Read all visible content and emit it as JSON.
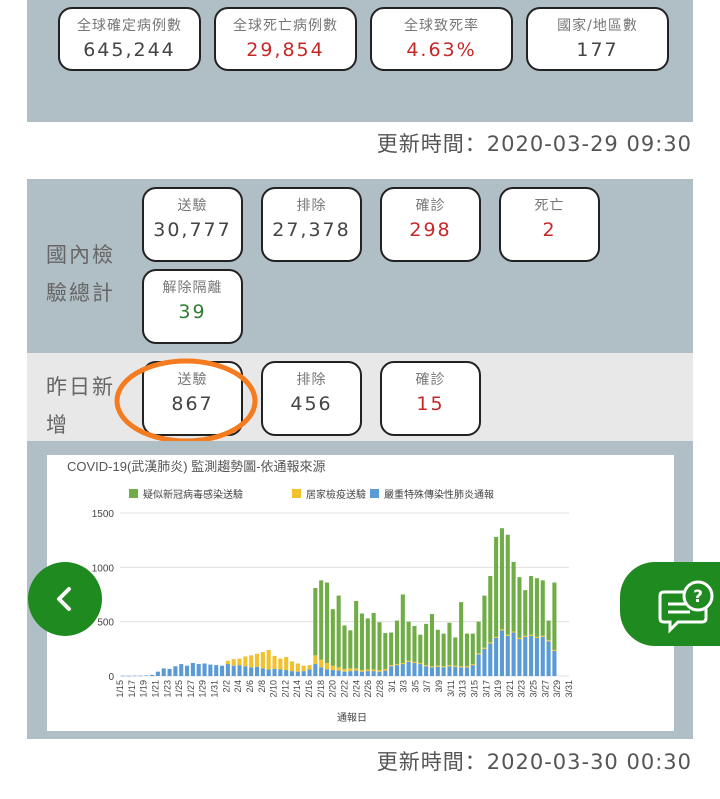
{
  "global": {
    "cards": [
      {
        "label": "全球確定病例數",
        "value": "645,244",
        "color": "#444444"
      },
      {
        "label": "全球死亡病例數",
        "value": "29,854",
        "color": "#c62828"
      },
      {
        "label": "全球致死率",
        "value": "4.63%",
        "color": "#c62828"
      },
      {
        "label": "國家/地區數",
        "value": "177",
        "color": "#444444"
      }
    ],
    "update": "更新時間：2020-03-29 09:30"
  },
  "domestic": {
    "title_line1": "國內檢",
    "title_line2": "驗總計",
    "cards": [
      {
        "label": "送驗",
        "value": "30,777"
      },
      {
        "label": "排除",
        "value": "27,378"
      },
      {
        "label": "確診",
        "value": "298"
      },
      {
        "label": "死亡",
        "value": "2"
      },
      {
        "label": "解除隔離",
        "value": "39"
      }
    ]
  },
  "yesterday": {
    "title_line1": "昨日新",
    "title_line2": "增",
    "cards": [
      {
        "label": "送驗",
        "value": "867"
      },
      {
        "label": "排除",
        "value": "456"
      },
      {
        "label": "確診",
        "value": "15"
      }
    ]
  },
  "update2": "更新時間：2020-03-30 00:30",
  "chart_data": {
    "type": "bar",
    "stacked": true,
    "title": "COVID-19(武漢肺炎) 監測趨勢圖-依通報來源",
    "xlabel": "通報日",
    "ylabel": "",
    "ylim": [
      0,
      1500
    ],
    "yticks": [
      0,
      500,
      1000,
      1500
    ],
    "legend_position": "top",
    "grid": true,
    "categories": [
      "1/15",
      "1/16",
      "1/17",
      "1/18",
      "1/19",
      "1/20",
      "1/21",
      "1/22",
      "1/23",
      "1/24",
      "1/25",
      "1/26",
      "1/27",
      "1/28",
      "1/29",
      "1/30",
      "1/31",
      "2/1",
      "2/2",
      "2/3",
      "2/4",
      "2/5",
      "2/6",
      "2/7",
      "2/8",
      "2/9",
      "2/10",
      "2/11",
      "2/12",
      "2/13",
      "2/14",
      "2/15",
      "2/16",
      "2/17",
      "2/18",
      "2/19",
      "2/20",
      "2/21",
      "2/22",
      "2/23",
      "2/24",
      "2/25",
      "2/26",
      "2/27",
      "2/28",
      "2/29",
      "3/1",
      "3/2",
      "3/3",
      "3/4",
      "3/5",
      "3/6",
      "3/7",
      "3/8",
      "3/9",
      "3/10",
      "3/11",
      "3/12",
      "3/13",
      "3/14",
      "3/15",
      "3/16",
      "3/17",
      "3/18",
      "3/19",
      "3/20",
      "3/21",
      "3/22",
      "3/23",
      "3/24",
      "3/25",
      "3/26",
      "3/27",
      "3/28",
      "3/29"
    ],
    "tick_labels": [
      "1/15",
      "1/17",
      "1/19",
      "1/21",
      "1/23",
      "1/25",
      "1/27",
      "1/29",
      "1/31",
      "2/2",
      "2/4",
      "2/6",
      "2/8",
      "2/10",
      "2/12",
      "2/14",
      "2/16",
      "2/18",
      "2/20",
      "2/22",
      "2/24",
      "2/26",
      "2/28",
      "3/1",
      "3/3",
      "3/5",
      "3/7",
      "3/9",
      "3/11",
      "3/13",
      "3/15",
      "3/17",
      "3/19",
      "3/21",
      "3/23",
      "3/25",
      "3/27",
      "3/29",
      "3/31"
    ],
    "series": [
      {
        "name": "嚴重特殊傳染性肺炎通報",
        "color": "#5b9bd5",
        "values": [
          2,
          2,
          3,
          3,
          5,
          10,
          40,
          70,
          65,
          90,
          110,
          95,
          120,
          110,
          115,
          105,
          100,
          95,
          110,
          95,
          100,
          90,
          80,
          85,
          70,
          60,
          65,
          60,
          55,
          45,
          40,
          45,
          60,
          110,
          80,
          60,
          55,
          50,
          40,
          45,
          50,
          40,
          45,
          45,
          40,
          50,
          90,
          100,
          110,
          130,
          120,
          110,
          90,
          80,
          85,
          80,
          90,
          85,
          80,
          80,
          100,
          200,
          250,
          300,
          350,
          420,
          370,
          400,
          340,
          360,
          370,
          350,
          360,
          320,
          230
        ]
      },
      {
        "name": "居家檢疫送驗",
        "color": "#f2c12e",
        "values": [
          0,
          0,
          0,
          0,
          0,
          0,
          0,
          0,
          0,
          0,
          0,
          0,
          0,
          0,
          0,
          0,
          0,
          0,
          30,
          60,
          60,
          90,
          110,
          120,
          150,
          180,
          120,
          100,
          120,
          90,
          75,
          50,
          40,
          80,
          70,
          60,
          40,
          30,
          25,
          25,
          20,
          15,
          15,
          15,
          15,
          15,
          10,
          10,
          10,
          10,
          10,
          10,
          10,
          10,
          10,
          10,
          10,
          10,
          10,
          10,
          10,
          10,
          10,
          10,
          10,
          10,
          10,
          10,
          10,
          10,
          10,
          10,
          10,
          10,
          10
        ]
      },
      {
        "name": "疑似新冠病毒感染送驗",
        "color": "#70ad47",
        "values": [
          0,
          0,
          0,
          0,
          0,
          0,
          0,
          0,
          0,
          0,
          0,
          0,
          0,
          0,
          0,
          0,
          0,
          0,
          0,
          0,
          0,
          0,
          0,
          0,
          0,
          0,
          0,
          0,
          0,
          0,
          0,
          0,
          0,
          620,
          730,
          740,
          520,
          660,
          400,
          350,
          620,
          520,
          470,
          520,
          440,
          330,
          300,
          400,
          630,
          360,
          330,
          260,
          380,
          480,
          330,
          300,
          390,
          260,
          590,
          300,
          280,
          290,
          480,
          610,
          920,
          930,
          920,
          640,
          560,
          420,
          540,
          540,
          510,
          180,
          620
        ]
      }
    ]
  }
}
